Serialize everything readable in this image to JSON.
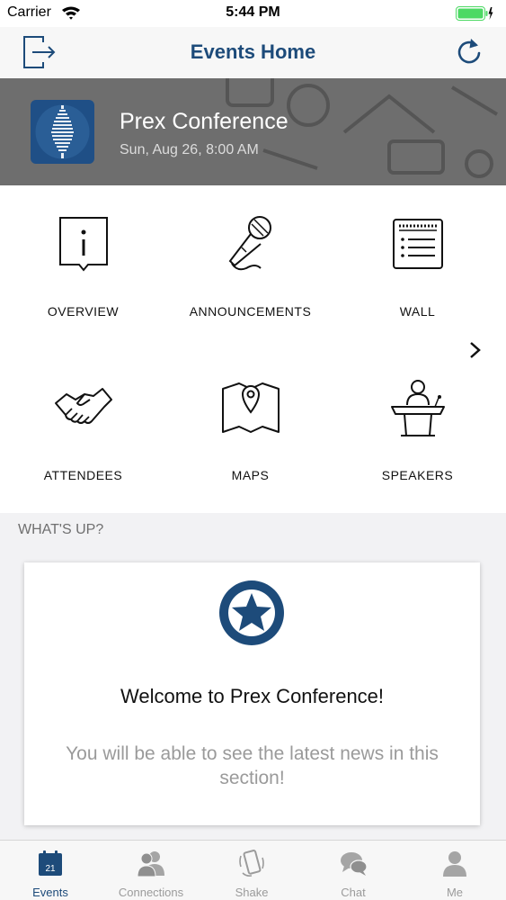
{
  "status_bar": {
    "carrier": "Carrier",
    "time": "5:44 PM"
  },
  "nav": {
    "title": "Events Home"
  },
  "event": {
    "name": "Prex Conference",
    "date": "Sun, Aug 26, 8:00 AM"
  },
  "menu": [
    {
      "label": "OVERVIEW",
      "icon": "info-panel-icon"
    },
    {
      "label": "ANNOUNCEMENTS",
      "icon": "microphone-icon"
    },
    {
      "label": "WALL",
      "icon": "wall-list-icon"
    },
    {
      "label": "ATTENDEES",
      "icon": "handshake-icon"
    },
    {
      "label": "MAPS",
      "icon": "map-pin-icon"
    },
    {
      "label": "SPEAKERS",
      "icon": "podium-speaker-icon"
    }
  ],
  "whats_up": {
    "header": "WHAT'S UP?",
    "card_title": "Welcome to Prex Conference!",
    "card_text": "You will be able to see the latest news in this section!"
  },
  "calendar_day": "21",
  "tabs": [
    {
      "label": "Events",
      "icon": "calendar-icon",
      "active": true
    },
    {
      "label": "Connections",
      "icon": "people-icon",
      "active": false
    },
    {
      "label": "Shake",
      "icon": "shake-phone-icon",
      "active": false
    },
    {
      "label": "Chat",
      "icon": "chat-bubbles-icon",
      "active": false
    },
    {
      "label": "Me",
      "icon": "person-icon",
      "active": false
    }
  ],
  "colors": {
    "accent": "#1d4b7a",
    "banner": "#6e6e6e",
    "battery": "#4cd964",
    "inactive_tab": "#9b9b9b"
  }
}
